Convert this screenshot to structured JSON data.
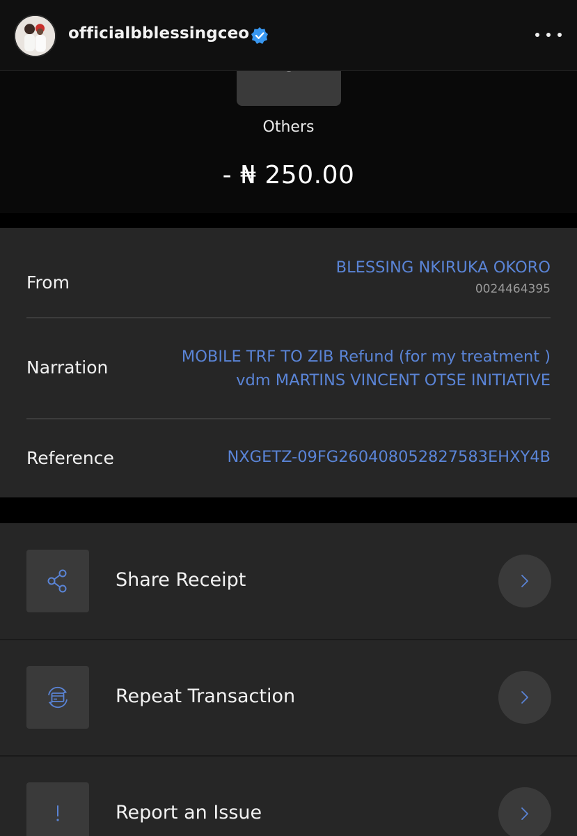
{
  "header": {
    "username": "officialbblessingceo",
    "verified_icon": "verified-badge-icon",
    "more_icon": "more-horizontal-icon"
  },
  "receipt": {
    "category_icon": "others-icon",
    "category": "Others",
    "amount": "- ₦ 250.00"
  },
  "details": {
    "from_label": "From",
    "from_name": "BLESSING NKIRUKA OKORO",
    "from_account": "0024464395",
    "narration_label": "Narration",
    "narration_line1": "MOBILE TRF TO ZIB Refund (for my treatment )",
    "narration_line2": "vdm MARTINS VINCENT OTSE INITIATIVE",
    "reference_label": "Reference",
    "reference_value": "NXGETZ-09FG260408052827583EHXY4B"
  },
  "actions": [
    {
      "label": "Share Receipt",
      "icon": "share-icon"
    },
    {
      "label": "Repeat Transaction",
      "icon": "repeat-transaction-icon"
    },
    {
      "label": "Report an Issue",
      "icon": "report-issue-icon"
    }
  ],
  "colors": {
    "accent": "#5a84d6",
    "card": "#262626",
    "tile": "#3a3a3a",
    "verified": "#3897f0"
  }
}
